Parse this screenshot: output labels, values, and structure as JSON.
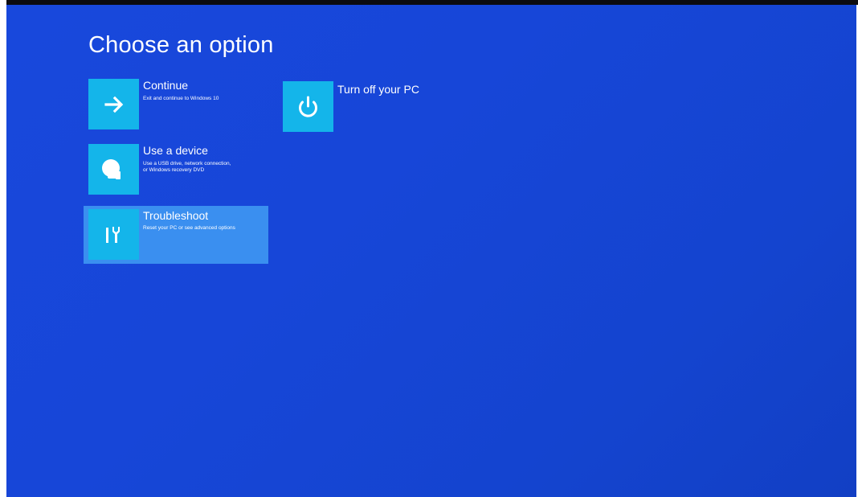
{
  "page_title": "Choose an option",
  "options": [
    {
      "id": "continue",
      "title": "Continue",
      "description_lines": [
        "Exit and continue to Windows 10"
      ],
      "icon": "arrow-right-icon",
      "selected": false
    },
    {
      "id": "use-device",
      "title": "Use a device",
      "description_lines": [
        "Use a USB drive, network connection,",
        "or Windows recovery DVD"
      ],
      "icon": "device-icon",
      "selected": false
    },
    {
      "id": "troubleshoot",
      "title": "Troubleshoot",
      "description_lines": [
        "Reset your PC or see advanced options"
      ],
      "icon": "tools-icon",
      "selected": true
    },
    {
      "id": "turn-off",
      "title": "Turn off your PC",
      "description_lines": [],
      "icon": "power-icon",
      "selected": false
    }
  ],
  "colors": {
    "background": "#1746d8",
    "tile": "#14b5ea",
    "selected_highlight": "#3a8ff0",
    "text": "#ffffff"
  }
}
